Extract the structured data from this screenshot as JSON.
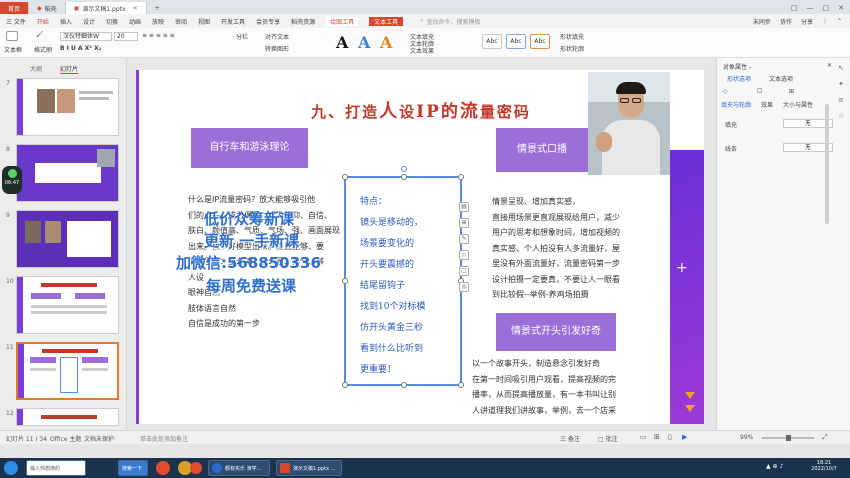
{
  "titlebar": {
    "tabs": [
      {
        "label": "首页"
      },
      {
        "label": "稻壳"
      },
      {
        "label": "演示文稿1.pptx"
      }
    ],
    "controls": [
      "□",
      "—",
      "□",
      "✕"
    ]
  },
  "menubar": {
    "items": [
      "三 文件",
      "开始",
      "插入",
      "设计",
      "切换",
      "动画",
      "放映",
      "审阅",
      "视图",
      "开发工具",
      "会员专享",
      "稻壳资源"
    ],
    "drawing_tools": "绘图工具",
    "text_tools": "文本工具",
    "search_placeholder": "查找命令、搜索模板",
    "right": [
      "未同步",
      "协作",
      "分享"
    ]
  },
  "ribbon": {
    "textbox": "文本框",
    "format_painter": "格式刷",
    "font_name": "汉仪特细体W",
    "font_size": "20",
    "bold_row": "B I U A X² X₂",
    "para_row": "≡ ≡ ≡ ≡ ≡",
    "columns": "分栏",
    "align_text": "对齐文本",
    "convert_smartart": "转换图形",
    "text_fill": "文本填充",
    "text_outline": "文本轮廓",
    "text_effect": "文本效果",
    "shape_fill": "形状填充",
    "shape_outline": "形状轮廓",
    "style_label": "Abc"
  },
  "leftpane": {
    "tabs": [
      "大纲",
      "幻灯片"
    ],
    "slide_numbers": [
      "7",
      "8",
      "9",
      "10",
      "11",
      "12"
    ]
  },
  "slide": {
    "title_parts": [
      "九、打造",
      "人",
      "设",
      "IP",
      "的",
      "流",
      "量密码"
    ],
    "left_heading": "自行车和游泳理论",
    "right_heading1": "情景式口播",
    "right_heading2": "情景式开头引发好奇",
    "left_body": [
      "什么是IP流量密码？放大能够吸引他",
      "们的点——成为偶像、成为信仰、自信、",
      "肤白、颜值高、气质、气场、强、画面展现",
      "出来。找个好模型出来。而且能够、要",
      "会吸引他：要么美、要么丑、帅气、够",
      "人设",
      "眼神自然",
      "肢体语言自然",
      "自信是成功的第一步"
    ],
    "speaker_lines": [
      "特点：",
      "镜头是移动的，",
      "场景要变化的",
      "开头要震撼的",
      "结尾留钩子",
      "找到10个对标模",
      "仿开头黄金三秒",
      "看到什么比听到",
      "更重要！"
    ],
    "right_body1": [
      "情景呈现、增加真实感，",
      "直接用场景更直观展现给用户，减少",
      "用户的思考和想象时间，增加视频的",
      "真实感、个人拍没有人多流量好，屋",
      "里没有外面流量好，流量密码第一步",
      "设计拍摄一定要真，不要让人一眼看",
      "到比较假--举例-养鸡场拍摄"
    ],
    "right_body2": [
      "以一个故事开头，制造悬念引发好奇",
      "在第一时间吸引用户观看，提高视频的完",
      "播率，从而提高播放量，有一本书叫让别",
      "人讲道理我们讲故事，举例，去一个店采"
    ],
    "watermark": {
      "line1": "低价众筹新课",
      "line2": "更新 一手新课",
      "line3": "加微信:568850336",
      "line4": "每周免费送课"
    }
  },
  "timer_badge": "06:47",
  "rightpane": {
    "title": "对象属性 -",
    "tabs": [
      "形状选项",
      "文本选项"
    ],
    "subtabs": [
      "填充与轮廓",
      "效果",
      "大小与属性"
    ],
    "fill_label": "填充",
    "fill_value": "无",
    "outline_label": "线条",
    "outline_value": "无"
  },
  "statusbar": {
    "slide_info": "幻灯片 11 / 34",
    "theme": "Office 主题",
    "spelling": "文档未保护",
    "notes_hint": "单击此处添加备注",
    "right_items": [
      "三 备注",
      "□ 批注"
    ],
    "zoom": "99%"
  },
  "taskbar": {
    "items": [
      "输入你想搜的",
      "搜索一下",
      "额有实乐 演学...",
      "演示文稿1.pptx ..."
    ],
    "time": "18:21",
    "date": "2022/10/7"
  }
}
